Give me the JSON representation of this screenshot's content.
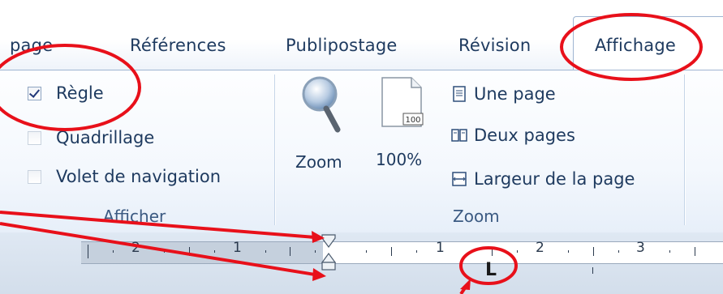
{
  "tabs": [
    {
      "label": "page"
    },
    {
      "label": "Références"
    },
    {
      "label": "Publipostage"
    },
    {
      "label": "Révision"
    },
    {
      "label": "Affichage",
      "active": true
    }
  ],
  "groups": {
    "afficher": {
      "label": "Afficher",
      "items": [
        {
          "label": "Règle",
          "checked": true
        },
        {
          "label": "Quadrillage",
          "checked": false
        },
        {
          "label": "Volet de navigation",
          "checked": false
        }
      ]
    },
    "zoom": {
      "label": "Zoom",
      "zoom_label": "Zoom",
      "percent_label": "100%",
      "percent_icon_text": "100",
      "items": [
        {
          "label": "Une page"
        },
        {
          "label": "Deux pages"
        },
        {
          "label": "Largeur de la page"
        }
      ]
    }
  },
  "ruler": {
    "numbers": [
      "2",
      "1",
      "1",
      "2",
      "3"
    ],
    "tab_stop_symbol": "L"
  },
  "colors": {
    "annotation": "#e8101a",
    "ribbon_text": "#1e3a5f",
    "group_label": "#3b5a82"
  }
}
